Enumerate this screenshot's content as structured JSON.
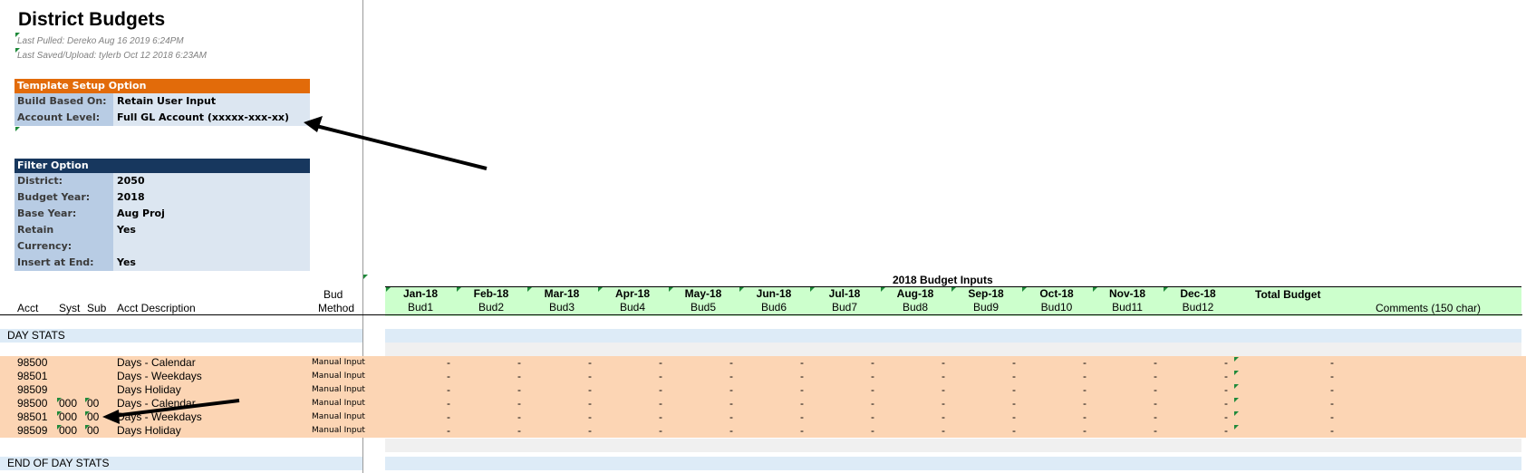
{
  "title": "District Budgets",
  "meta": {
    "last_pulled": "Last Pulled: Dereko Aug 16 2019  6:24PM",
    "last_saved": "Last Saved/Upload: tylerb Oct 12 2018  6:23AM"
  },
  "template_setup": {
    "header": "Template Setup Option",
    "rows": [
      {
        "label": "Build Based On:",
        "value": "Retain User Input"
      },
      {
        "label": "Account Level:",
        "value": "Full GL Account (xxxxx-xxx-xx)"
      }
    ]
  },
  "filter_option": {
    "header": "Filter Option",
    "rows": [
      {
        "label": "District:",
        "value": "2050"
      },
      {
        "label": "Budget Year:",
        "value": "2018"
      },
      {
        "label": "Base Year:",
        "value": "Aug Proj"
      },
      {
        "label": "Retain Comments:",
        "value": "Yes"
      },
      {
        "label": "Currency:",
        "value": ""
      },
      {
        "label": "Insert at End:",
        "value": "Yes"
      }
    ]
  },
  "columns": {
    "acct": "Acct",
    "syst": "Syst",
    "sub": "Sub",
    "desc": "Acct Description",
    "bud_method_1": "Bud",
    "bud_method_2": "Method",
    "budget_inputs_title": "2018 Budget Inputs",
    "total_budget": "Total Budget",
    "comments": "Comments (150 char)",
    "months": [
      {
        "month": "Jan-18",
        "bud": "Bud1"
      },
      {
        "month": "Feb-18",
        "bud": "Bud2"
      },
      {
        "month": "Mar-18",
        "bud": "Bud3"
      },
      {
        "month": "Apr-18",
        "bud": "Bud4"
      },
      {
        "month": "May-18",
        "bud": "Bud5"
      },
      {
        "month": "Jun-18",
        "bud": "Bud6"
      },
      {
        "month": "Jul-18",
        "bud": "Bud7"
      },
      {
        "month": "Aug-18",
        "bud": "Bud8"
      },
      {
        "month": "Sep-18",
        "bud": "Bud9"
      },
      {
        "month": "Oct-18",
        "bud": "Bud10"
      },
      {
        "month": "Nov-18",
        "bud": "Bud11"
      },
      {
        "month": "Dec-18",
        "bud": "Bud12"
      }
    ]
  },
  "sections": {
    "start": "DAY STATS",
    "end": "END OF DAY STATS"
  },
  "rows": [
    {
      "acct": "98500",
      "syst": "",
      "sub": "",
      "desc": "Days - Calendar",
      "method": "Manual Input"
    },
    {
      "acct": "98501",
      "syst": "",
      "sub": "",
      "desc": "Days - Weekdays",
      "method": "Manual Input"
    },
    {
      "acct": "98509",
      "syst": "",
      "sub": "",
      "desc": "Days Holiday",
      "method": "Manual Input"
    },
    {
      "acct": "98500",
      "syst": "000",
      "sub": "00",
      "desc": "Days - Calendar",
      "method": "Manual Input"
    },
    {
      "acct": "98501",
      "syst": "000",
      "sub": "00",
      "desc": "Days - Weekdays",
      "method": "Manual Input"
    },
    {
      "acct": "98509",
      "syst": "000",
      "sub": "00",
      "desc": "Days Holiday",
      "method": "Manual Input"
    }
  ],
  "dash": "-",
  "colors": {
    "template_header": "#e26b0a",
    "filter_header": "#17375e",
    "label_bg": "#b8cce4",
    "value_bg": "#dce6f1",
    "budget_band": "#ccffcc",
    "data_rows": "#fcd5b4",
    "section_band": "#ddebf7"
  }
}
